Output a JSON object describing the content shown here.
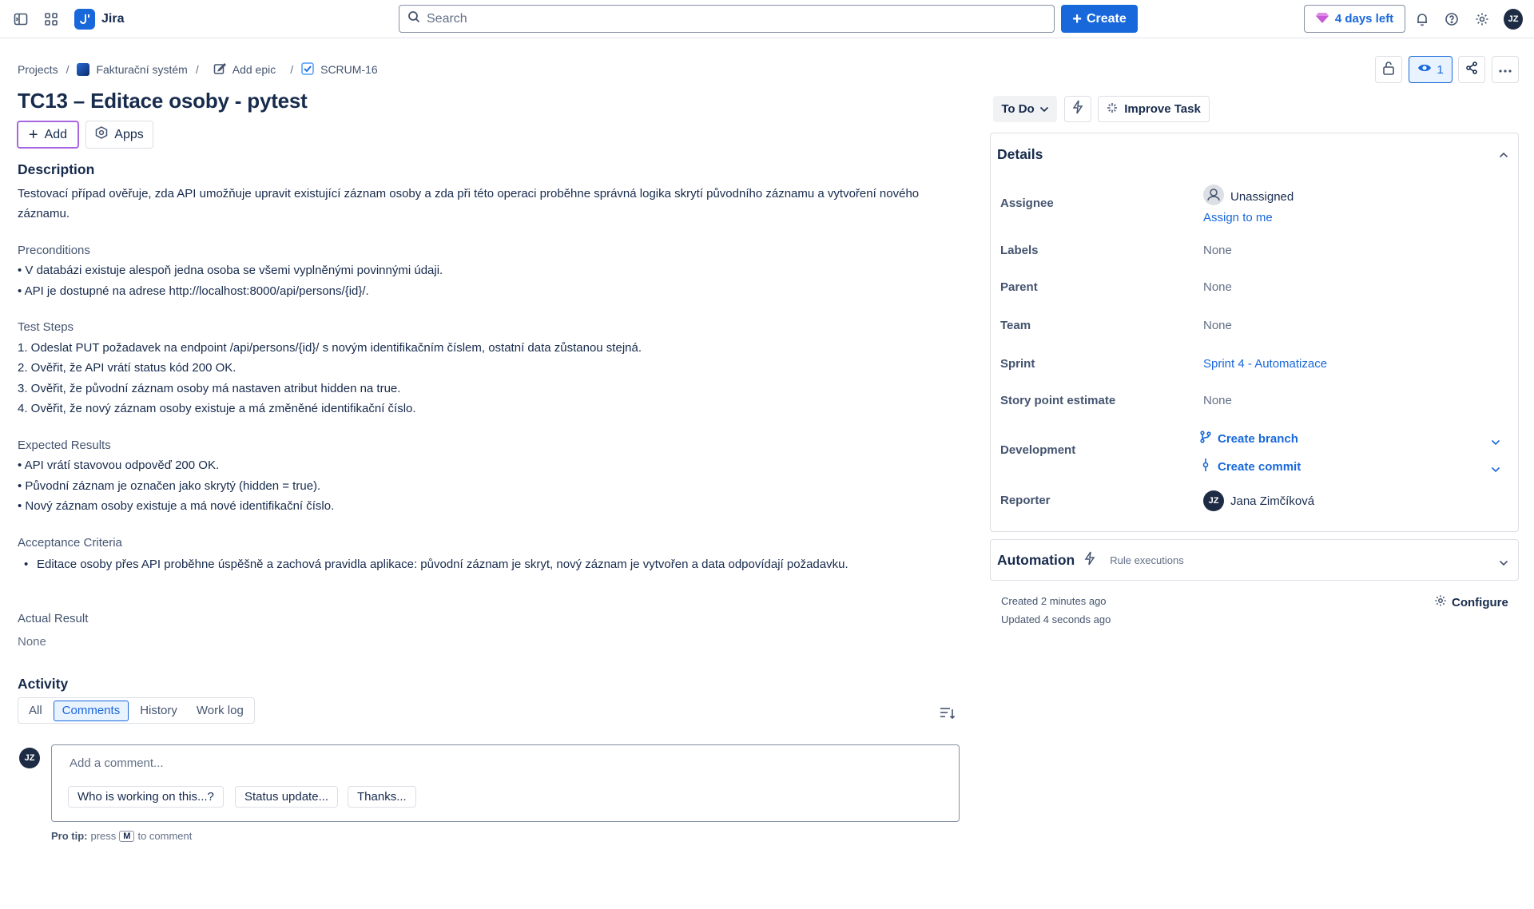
{
  "topbar": {
    "app_name": "Jira",
    "search_placeholder": "Search",
    "create_label": "Create",
    "trial_label": "4 days left",
    "user_initials": "JZ"
  },
  "breadcrumb": {
    "projects": "Projects",
    "project": "Fakturační systém",
    "add_epic": "Add epic",
    "issue_key": "SCRUM-16"
  },
  "toolbar": {
    "watchers_count": "1"
  },
  "issue": {
    "title": "TC13 – Editace osoby - pytest",
    "add_label": "Add",
    "apps_label": "Apps",
    "description_heading": "Description",
    "description_text": "Testovací případ ověřuje, zda API umožňuje upravit existující záznam osoby a zda při této operaci proběhne správná logika skrytí původního záznamu a vytvoření nového záznamu.",
    "preconditions_title": "Preconditions",
    "preconditions": [
      "• V databázi existuje alespoň jedna osoba se všemi vyplněnými povinnými údaji.",
      "• API je dostupné na adrese http://localhost:8000/api/persons/{id}/."
    ],
    "steps_title": "Test Steps",
    "steps": [
      "1. Odeslat PUT požadavek na endpoint /api/persons/{id}/ s novým identifikačním číslem, ostatní data zůstanou stejná.",
      "2. Ověřit, že API vrátí status kód 200 OK.",
      "3. Ověřit, že původní záznam osoby má nastaven atribut hidden na true.",
      "4. Ověřit, že nový záznam osoby existuje a má změněné identifikační číslo."
    ],
    "expected_title": "Expected Results",
    "expected": [
      "• API vrátí stavovou odpověď 200 OK.",
      "• Původní záznam je označen jako skrytý (hidden = true).",
      "• Nový záznam osoby existuje a má nové identifikační číslo."
    ],
    "acceptance_title": "Acceptance Criteria",
    "acceptance": [
      "Editace osoby přes API proběhne úspěšně a zachová pravidla aplikace: původní záznam je skryt, nový záznam je vytvořen a data odpovídají požadavku."
    ],
    "actual_title": "Actual Result",
    "actual_value": "None"
  },
  "activity": {
    "heading": "Activity",
    "tabs": [
      "All",
      "Comments",
      "History",
      "Work log"
    ],
    "active_tab": "Comments",
    "comment_placeholder": "Add a comment...",
    "suggestions": [
      "Who is working on this...?",
      "Status update...",
      "Thanks..."
    ],
    "protip_label": "Pro tip:",
    "protip_press": "press",
    "protip_key": "M",
    "protip_rest": "to comment",
    "user_initials": "JZ"
  },
  "side": {
    "status": "To Do",
    "improve_label": "Improve Task",
    "details_heading": "Details",
    "assignee_label": "Assignee",
    "assignee_value": "Unassigned",
    "assign_to_me": "Assign to me",
    "labels_label": "Labels",
    "labels_value": "None",
    "parent_label": "Parent",
    "parent_value": "None",
    "team_label": "Team",
    "team_value": "None",
    "sprint_label": "Sprint",
    "sprint_value": "Sprint 4 - Automatizace",
    "story_label": "Story point estimate",
    "story_value": "None",
    "development_label": "Development",
    "create_branch": "Create branch",
    "create_commit": "Create commit",
    "reporter_label": "Reporter",
    "reporter_initials": "JZ",
    "reporter_name": "Jana Zimčíková",
    "automation_heading": "Automation",
    "rule_executions": "Rule executions",
    "created": "Created 2 minutes ago",
    "updated": "Updated 4 seconds ago",
    "configure_label": "Configure"
  },
  "colors": {
    "accent": "#1868db",
    "text": "#172b4d",
    "subtle": "#44546f",
    "add_border": "#a865e0"
  }
}
